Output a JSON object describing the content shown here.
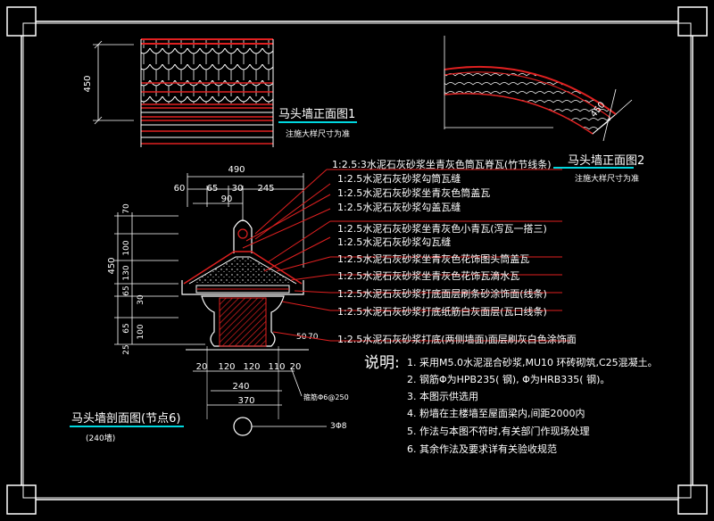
{
  "front_view_1": {
    "height_dim": "450",
    "title": "马头墙正面图1",
    "subtitle": "注施大样尺寸为准"
  },
  "front_view_2": {
    "dim": "450",
    "title": "马头墙正面图2",
    "subtitle": "注施大样尺寸为准"
  },
  "section": {
    "top_dims": [
      "490",
      "60",
      "65",
      "30",
      "245",
      "90"
    ],
    "left_dims": [
      "70",
      "100",
      "450",
      "130",
      "65",
      "30",
      "65",
      "100",
      "25"
    ],
    "bottom_dims": [
      "20",
      "120",
      "120",
      "110",
      "20",
      "240",
      "370"
    ],
    "right_dims": [
      "50",
      "70"
    ],
    "rebar_label": "箍筋Φ6@250",
    "pile_label": "3Φ8",
    "title": "马头墙剖面图(节点6)",
    "subtitle": "(240墙)"
  },
  "callouts": [
    "1:2.5:3水泥石灰砂浆坐青灰色筒瓦脊瓦(竹节线条)",
    "1:2.5水泥石灰砂浆勾筒瓦缝",
    "1:2.5水泥石灰砂浆坐青灰色筒盖瓦",
    "1:2.5水泥石灰砂浆勾盖瓦缝",
    "1:2.5水泥石灰砂浆坐青灰色小青瓦(泻瓦一搭三)",
    "1:2.5水泥石灰砂浆勾瓦缝",
    "1:2.5水泥石灰砂浆坐青灰色花饰图头筒盖瓦",
    "1:2.5水泥石灰砂浆坐青灰色花饰瓦滴水瓦",
    "1:2.5水泥石灰砂浆打底面层刷条砂涂饰面(线条)",
    "1:2.5水泥石灰砂浆打底纸筋白灰面层(瓦口线条)",
    "1:2.5水泥石灰砂浆打底(两侧墙面)面层刷灰白色涂饰面"
  ],
  "notes": {
    "heading": "说明:",
    "items": [
      "1. 采用M5.0水泥混合砂浆,MU10  环砖砌筑,C25混凝土。",
      "2. 钢筋Φ为HPB235(  钢),  Φ为HRB335(  钢)。",
      "3. 本图示供选用",
      "4. 粉墙在主楼墙至屋面梁内,间距2000内",
      "5. 作法与本图不符时,有关部门作现场处理",
      "6. 其余作法及要求详有关验收规范"
    ]
  }
}
